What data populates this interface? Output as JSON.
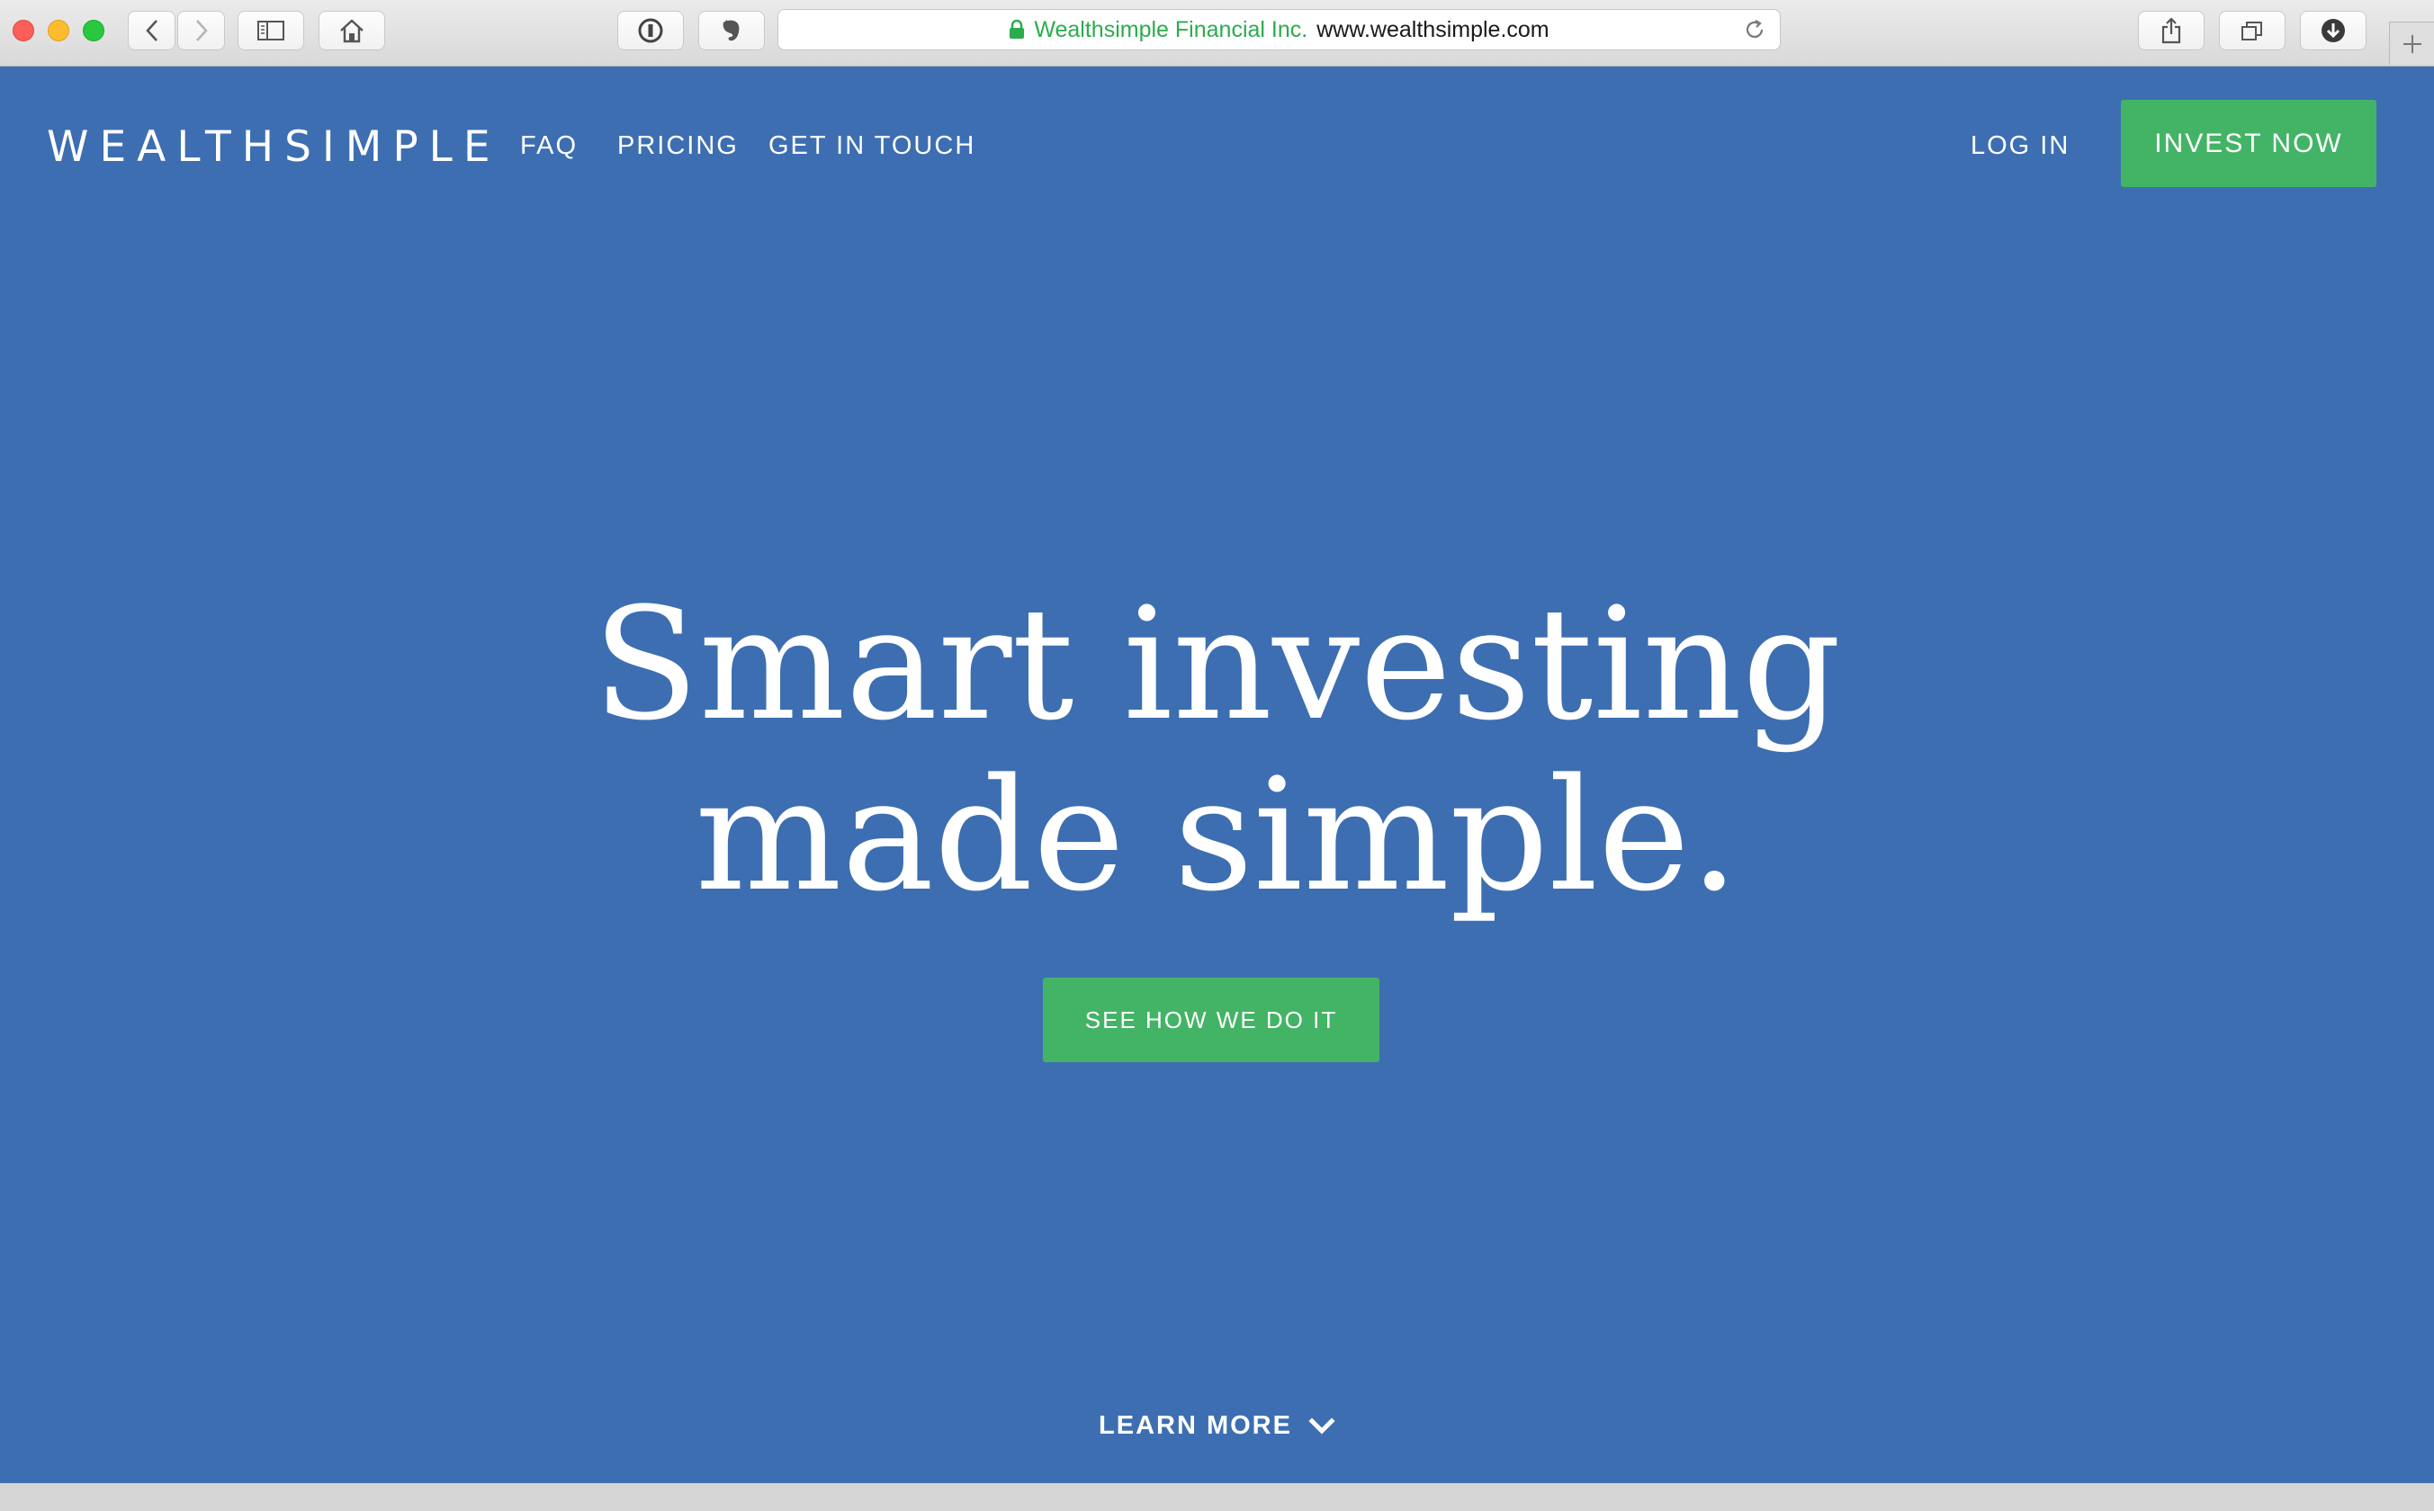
{
  "browser": {
    "address": {
      "company": "Wealthsimple Financial Inc.",
      "domain": "www.wealthsimple.com"
    },
    "icons": {
      "back": "chevron-left-icon",
      "forward": "chevron-right-icon",
      "sidebar": "sidebar-icon",
      "home": "home-icon",
      "password": "password-manager-icon",
      "evernote": "evernote-icon",
      "lock": "lock-icon",
      "reload": "reload-icon",
      "share": "share-icon",
      "tabs": "tabs-overview-icon",
      "downloads": "download-icon",
      "new_tab": "plus-icon"
    }
  },
  "site": {
    "logo": "WEALTHSIMPLE",
    "nav": {
      "items": [
        "FAQ",
        "PRICING",
        "GET IN TOUCH"
      ],
      "login": "LOG IN",
      "cta": "INVEST NOW"
    },
    "hero": {
      "line1": "Smart investing",
      "line2": "made simple.",
      "button": "SEE HOW WE DO IT"
    },
    "learn_more": "LEARN MORE"
  },
  "colors": {
    "background": "#3d6eb1",
    "accent_green": "#43b466",
    "text": "#ffffff",
    "secure_company_text": "#2bac4e"
  }
}
